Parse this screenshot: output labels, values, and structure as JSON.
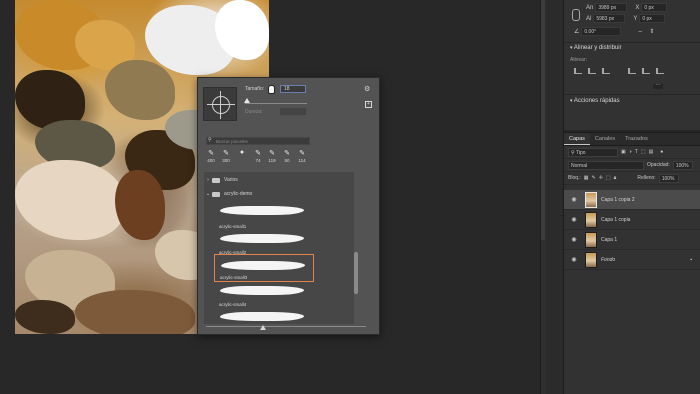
{
  "properties": {
    "w_label": "An",
    "w_value": "3989 px",
    "h_label": "Al",
    "h_value": "5983 px",
    "x_value": "0 px",
    "y_value": "0 px",
    "angle_value": "0.00°",
    "align_section": "Alinear y distribuir",
    "align_label": "Alinear:",
    "quick_actions": "Acciones rápidas"
  },
  "layers_panel": {
    "tabs": [
      "Capas",
      "Canales",
      "Trazados"
    ],
    "filter_value": "Tipo",
    "blend_mode": "Normal",
    "opacity_label": "Opacidad:",
    "opacity_value": "100%",
    "lock_label": "Bloq.:",
    "fill_label": "Relleno:",
    "fill_value": "100%",
    "layers": [
      {
        "name": "Capa 1 copia 2",
        "selected": true
      },
      {
        "name": "Capa 1 copia",
        "selected": false
      },
      {
        "name": "Capa 1",
        "selected": false
      },
      {
        "name": "Fondo",
        "selected": false
      }
    ]
  },
  "brush_popup": {
    "size_label": "Tamaño:",
    "size_value": "18",
    "hardness_label": "Dureza:",
    "search_placeholder": "Buscar pinceles",
    "recent_brushes": [
      "400",
      "300",
      "",
      "74",
      "119",
      "50",
      "114"
    ],
    "folders": [
      "Varios",
      "acrylic-demo"
    ],
    "brushes": [
      "acrylic-small1",
      "acrylic-small2",
      "acrylic-small3",
      "acrylic-small4"
    ],
    "selected_brush": "acrylic-small3"
  },
  "colors": {
    "accent_selected": "#e2844a",
    "panel_bg": "#323232",
    "popup_bg": "#535353"
  }
}
